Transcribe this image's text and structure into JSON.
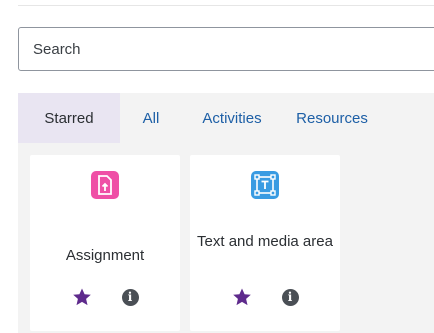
{
  "search": {
    "placeholder": "Search",
    "value": ""
  },
  "tabs": [
    {
      "label": "Starred",
      "active": true
    },
    {
      "label": "All",
      "active": false
    },
    {
      "label": "Activities",
      "active": false
    },
    {
      "label": "Resources",
      "active": false
    }
  ],
  "cards": [
    {
      "name": "Assignment",
      "icon": "assignment-icon",
      "icon_color": "#ef4fa6",
      "starred": true
    },
    {
      "name": "Text and media area",
      "icon": "text-media-area-icon",
      "icon_color": "#399be2",
      "starred": true
    }
  ],
  "colors": {
    "star": "#5e2a8c",
    "active_tab_bg": "#e9e5f2",
    "link": "#1d5fa6"
  }
}
